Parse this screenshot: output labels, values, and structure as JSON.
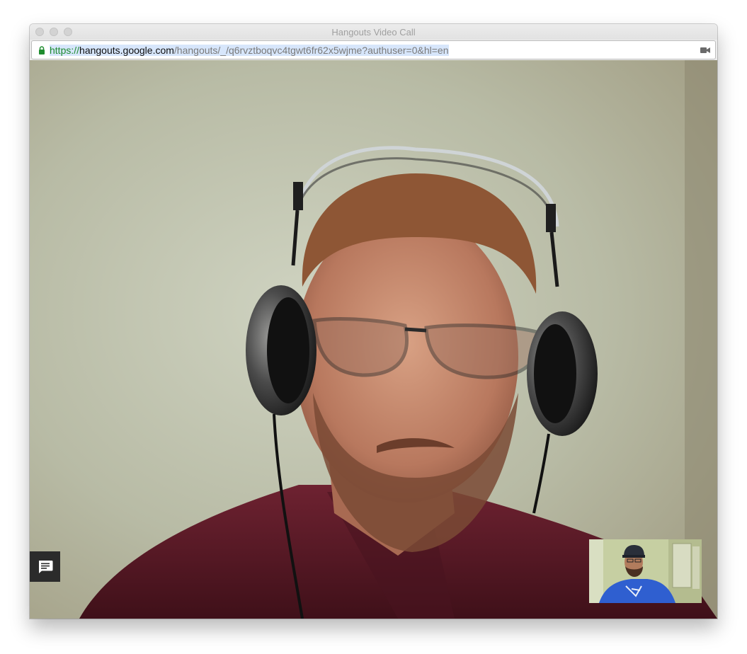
{
  "window": {
    "title": "Hangouts Video Call"
  },
  "address_bar": {
    "url_scheme": "https://",
    "url_host": "hangouts.google.com",
    "url_path": "/hangouts/_/q6rvztboqvc4tgwt6fr62x5wjme?authuser=0&hl=en",
    "secure_icon": "lock-icon",
    "action_icon": "video-camera-icon"
  },
  "call": {
    "main_feed": "remote-participant-video",
    "self_view": "local-camera-preview",
    "chat_icon": "chat-bubble-icon"
  },
  "colors": {
    "secure_green": "#1f8c2f",
    "chat_button_bg": "#2b2b2b",
    "shirt_maroon": "#6b1d2c"
  }
}
